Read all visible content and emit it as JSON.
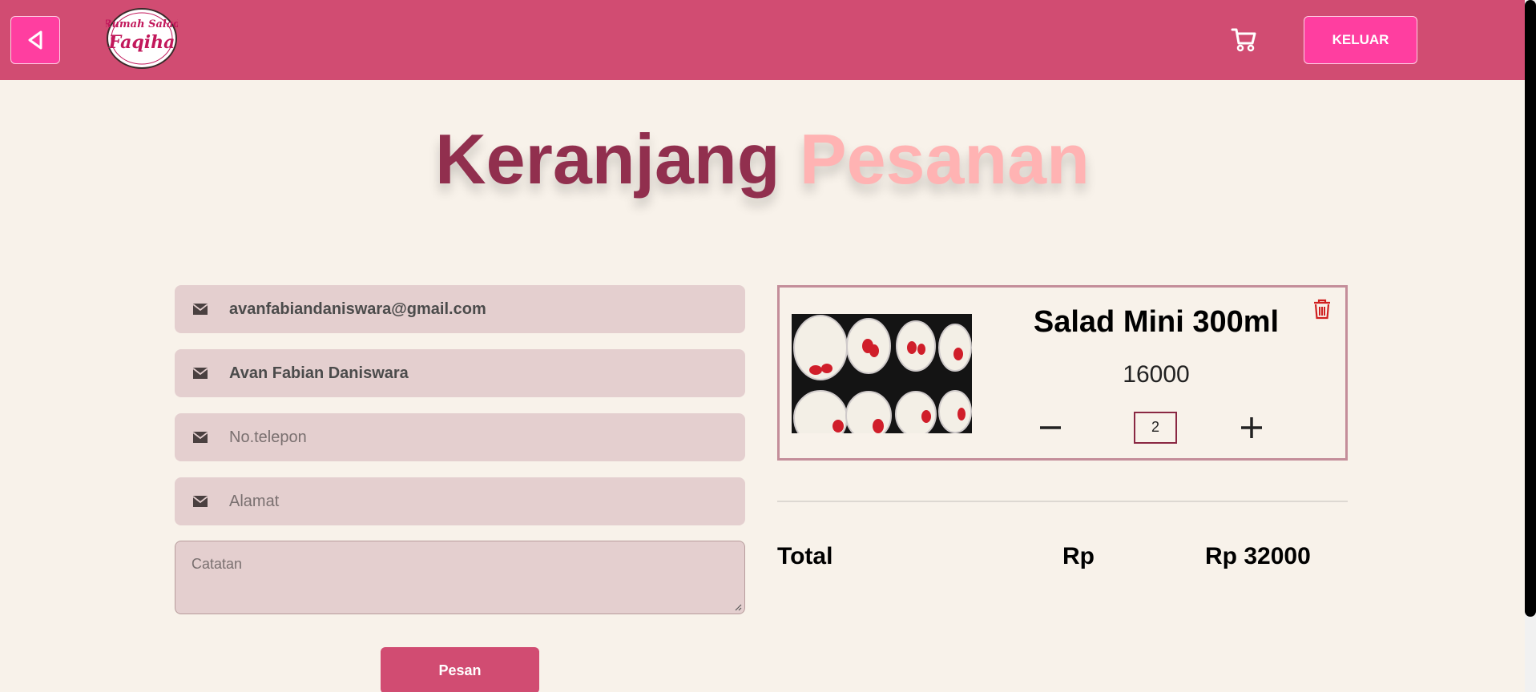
{
  "header": {
    "logo_text_top": "Rumah Salad",
    "logo_text_main": "Faqiha",
    "logout_label": "KELUAR",
    "icons": {
      "back": "back-arrow-icon",
      "cart": "cart-icon"
    }
  },
  "title": {
    "part1": "Keranjang",
    "part2": "Pesanan"
  },
  "form": {
    "email": "avanfabiandaniswara@gmail.com",
    "name": "Avan Fabian Daniswara",
    "phone_placeholder": "No.telepon",
    "address_placeholder": "Alamat",
    "notes_placeholder": "Catatan",
    "submit_label": "Pesan",
    "field_icon": "envelope-icon"
  },
  "cart": {
    "items": [
      {
        "name": "Salad Mini 300ml",
        "price": "16000",
        "qty": "2"
      }
    ],
    "total_label": "Total",
    "currency": "Rp",
    "total_value": "Rp 32000"
  },
  "colors": {
    "header": "#d14c72",
    "accent_button": "#ff3ea0",
    "title_dark": "#912f4e",
    "title_light": "#ffb3b3",
    "field_bg": "#e4cfcf",
    "background": "#f8f2ea"
  }
}
